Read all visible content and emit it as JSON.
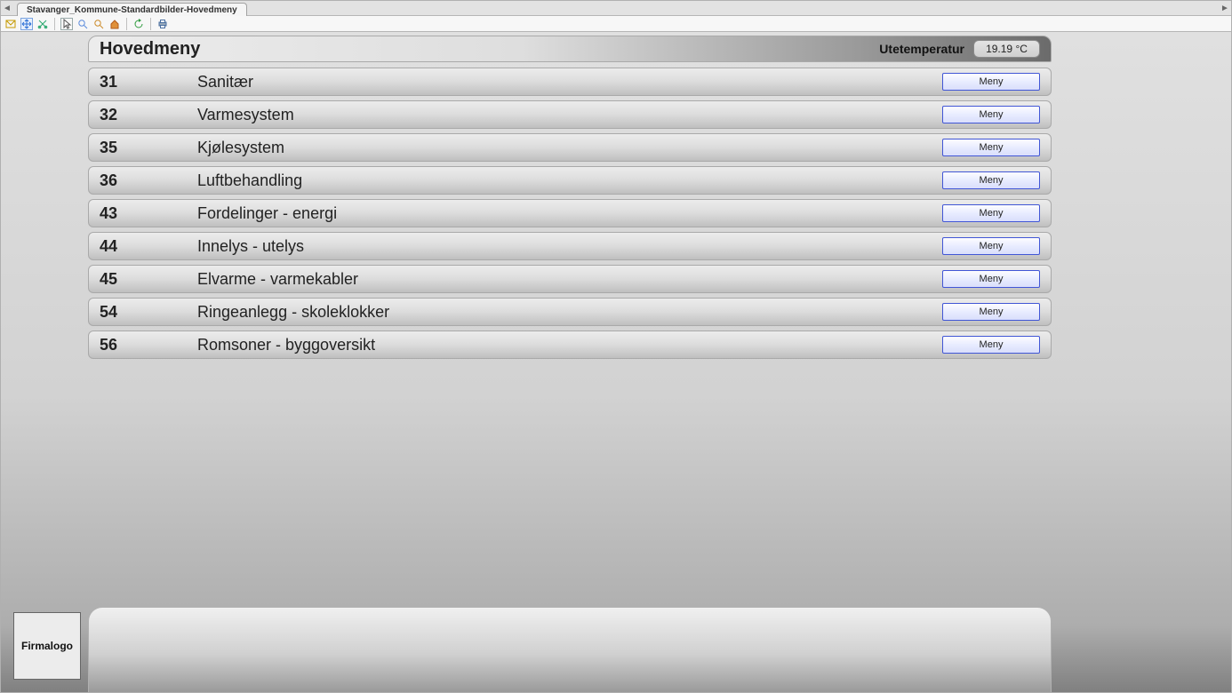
{
  "tab": {
    "title": "Stavanger_Kommune-Standardbilder-Hovedmeny"
  },
  "toolbar": {
    "icons": [
      {
        "name": "mail-icon",
        "color": "#c59a00"
      },
      {
        "name": "move-icon",
        "color": "#2a6fd6"
      },
      {
        "name": "cut-icon",
        "color": "#2aa86f"
      },
      {
        "name": "pointer-icon",
        "color": "#555555"
      },
      {
        "name": "zoom-in-icon",
        "color": "#5b8bdc"
      },
      {
        "name": "zoom-out-icon",
        "color": "#cc8b2a"
      },
      {
        "name": "home-icon",
        "color": "#b25a1a"
      },
      {
        "name": "refresh-icon",
        "color": "#2e9a3e"
      },
      {
        "name": "print-icon",
        "color": "#4a6fa0"
      }
    ]
  },
  "header": {
    "title": "Hovedmeny",
    "temp_label": "Utetemperatur",
    "temp_value": "19.19 °C"
  },
  "rows": [
    {
      "code": "31",
      "label": "Sanitær",
      "button": "Meny"
    },
    {
      "code": "32",
      "label": "Varmesystem",
      "button": "Meny"
    },
    {
      "code": "35",
      "label": "Kjølesystem",
      "button": "Meny"
    },
    {
      "code": "36",
      "label": "Luftbehandling",
      "button": "Meny"
    },
    {
      "code": "43",
      "label": "Fordelinger - energi",
      "button": "Meny"
    },
    {
      "code": "44",
      "label": "Innelys - utelys",
      "button": "Meny"
    },
    {
      "code": "45",
      "label": "Elvarme - varmekabler",
      "button": "Meny"
    },
    {
      "code": "54",
      "label": "Ringeanlegg - skoleklokker",
      "button": "Meny"
    },
    {
      "code": "56",
      "label": "Romsoner - byggoversikt",
      "button": "Meny"
    }
  ],
  "footer": {
    "logo_text": "Firmalogo"
  }
}
